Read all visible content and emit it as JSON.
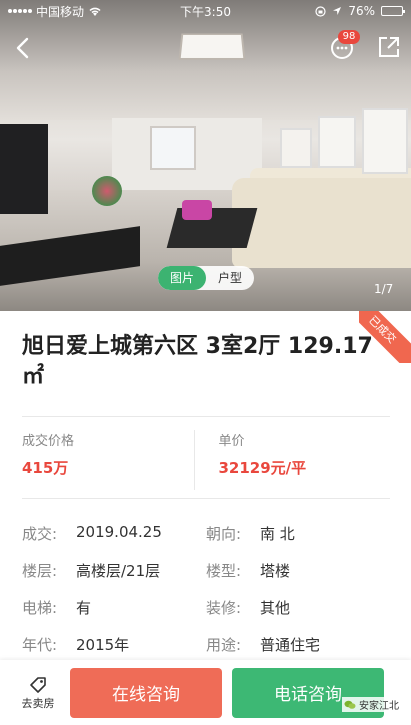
{
  "status_bar": {
    "carrier": "中国移动",
    "time": "下午3:50",
    "battery": "76%",
    "battery_level": 0.76
  },
  "nav": {
    "message_badge": "98"
  },
  "photo": {
    "tabs": [
      {
        "label": "图片",
        "active": true
      },
      {
        "label": "户型",
        "active": false
      }
    ],
    "counter": "1/7"
  },
  "ribbon": "已成交",
  "listing": {
    "title": "旭日爱上城第六区 3室2厅 129.17㎡",
    "deal_price_label": "成交价格",
    "deal_price": "415万",
    "unit_price_label": "单价",
    "unit_price": "32129元/平"
  },
  "details": [
    {
      "key": "成交:",
      "value": "2019.04.25",
      "key2": "朝向:",
      "value2": "南 北"
    },
    {
      "key": "楼层:",
      "value": "高楼层/21层",
      "key2": "楼型:",
      "value2": "塔楼"
    },
    {
      "key": "电梯:",
      "value": "有",
      "key2": "装修:",
      "value2": "其他"
    },
    {
      "key": "年代:",
      "value": "2015年",
      "key2": "用途:",
      "value2": "普通住宅"
    }
  ],
  "bottom": {
    "sell_label": "去卖房",
    "online_label": "在线咨询",
    "phone_label": "电话咨询"
  },
  "watermark": "安家江北",
  "colors": {
    "accent_red": "#e9473d",
    "btn_online": "#ef6c57",
    "btn_phone": "#3db874",
    "tab_active": "#3cb371"
  }
}
